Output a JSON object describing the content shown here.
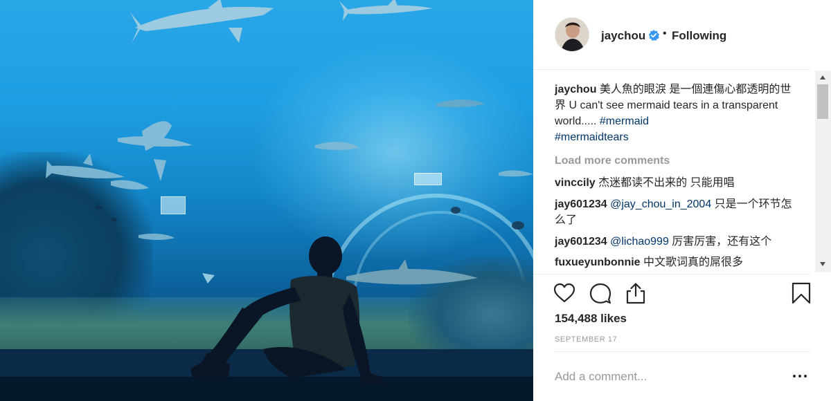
{
  "post": {
    "author": "jaychou",
    "follow_status": "Following",
    "caption": {
      "username": "jaychou",
      "text": " 美人魚的眼淚 是一個連傷心都透明的世界 U can't see mermaid tears in a transparent world..... ",
      "hashtags": [
        "#mermaid",
        "#mermaidtears"
      ]
    },
    "load_more_label": "Load more comments",
    "comments": [
      {
        "username": "vinccily",
        "mention": "",
        "text": " 杰迷都读不出来的 只能用唱"
      },
      {
        "username": "jay601234",
        "mention": "@jay_chou_in_2004",
        "text": " 只是一个环节怎么了"
      },
      {
        "username": "jay601234",
        "mention": "@lichao999",
        "text": " 厉害厉害，还有这个"
      },
      {
        "username": "fuxueyunbonnie",
        "mention": "",
        "text": " 中文歌词真的屌很多"
      }
    ],
    "likes": "154,488 likes",
    "date": "SEPTEMBER 17",
    "comment_placeholder": "Add a comment..."
  },
  "icons": {
    "like": "heart-icon",
    "comment": "speech-bubble-icon",
    "share": "share-icon",
    "save": "bookmark-icon",
    "verified": "verified-badge-icon",
    "more": "more-options-icon"
  },
  "colors": {
    "verified_blue": "#3897f0",
    "link": "#003569",
    "muted": "#999999",
    "text": "#262626"
  }
}
